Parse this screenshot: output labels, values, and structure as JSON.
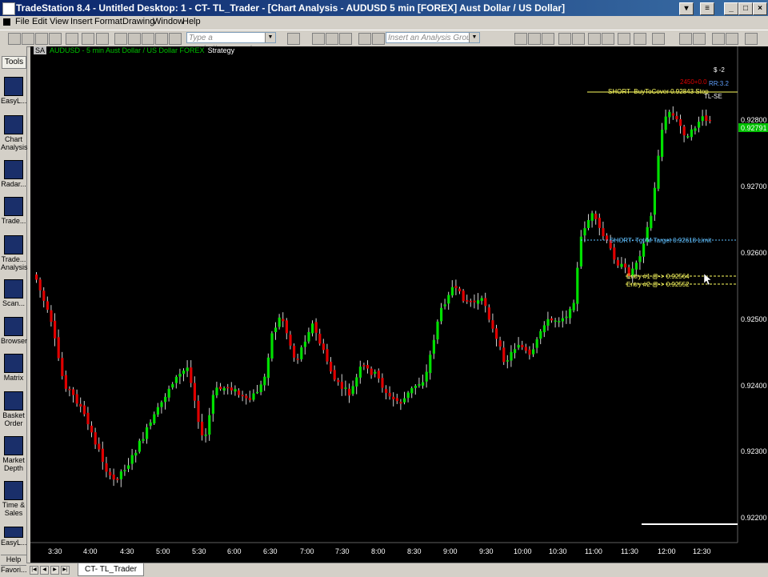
{
  "window": {
    "title": "TradeStation 8.4 - Untitled Desktop: 1 - CT- TL_Trader - [Chart Analysis - AUDUSD  5 min  [FOREX] Aust Dollar / US Dollar]"
  },
  "menu": [
    "File",
    "Edit",
    "View",
    "Insert",
    "Format",
    "Drawing",
    "Window",
    "Help"
  ],
  "toolbar": {
    "symbol_placeholder": "Type a symbol/command",
    "analysis_placeholder": "Insert an Analysis Group"
  },
  "tools": {
    "header": "Tools",
    "items": [
      {
        "label": "EasyL..."
      },
      {
        "label": "Chart Analysis"
      },
      {
        "label": "Radar..."
      },
      {
        "label": "Trade..."
      },
      {
        "label": "Trade... Analysis"
      },
      {
        "label": "Scan..."
      },
      {
        "label": "Browser"
      },
      {
        "label": "Matrix"
      },
      {
        "label": "Basket Order"
      },
      {
        "label": "Market Depth"
      },
      {
        "label": "Time & Sales"
      },
      {
        "label": "EasyL..."
      }
    ],
    "bottom": [
      "Help",
      "Favori..."
    ]
  },
  "chart": {
    "sa_label": "SA",
    "symbol_line": "AUDUSD - 5 min  Aust Dollar / US Dollar  FOREX",
    "strategy_label": "Strategy",
    "price_labels": [
      "0.92800",
      "0.92700",
      "0.92600",
      "0.92500",
      "0.92400",
      "0.92300",
      "0.92200"
    ],
    "current_price": "0.92791",
    "time_labels": [
      "3:30",
      "4:00",
      "4:30",
      "5:00",
      "5:30",
      "6:00",
      "6:30",
      "7:00",
      "7:30",
      "8:00",
      "8:30",
      "9:00",
      "9:30",
      "10:00",
      "10:30",
      "11:00",
      "11:30",
      "12:00",
      "12:30"
    ],
    "annotations": {
      "position": "$ -2",
      "pnl": "2450+0.0",
      "rr": "RR:3.2",
      "tl": "TL-SE",
      "stop": "SHORT- BuyToCover 0.92843 Stop",
      "target": "SHORT- Tgt/M Target 0.92618 Limit",
      "entry1": "Entry #1 @-> 0.92564",
      "entry2": "Entry #2 @-> 0.92552"
    },
    "colors": {
      "up": "#00e000",
      "down": "#e00000",
      "background": "#000000"
    }
  },
  "tabs": {
    "active": "CT- TL_Trader"
  }
}
